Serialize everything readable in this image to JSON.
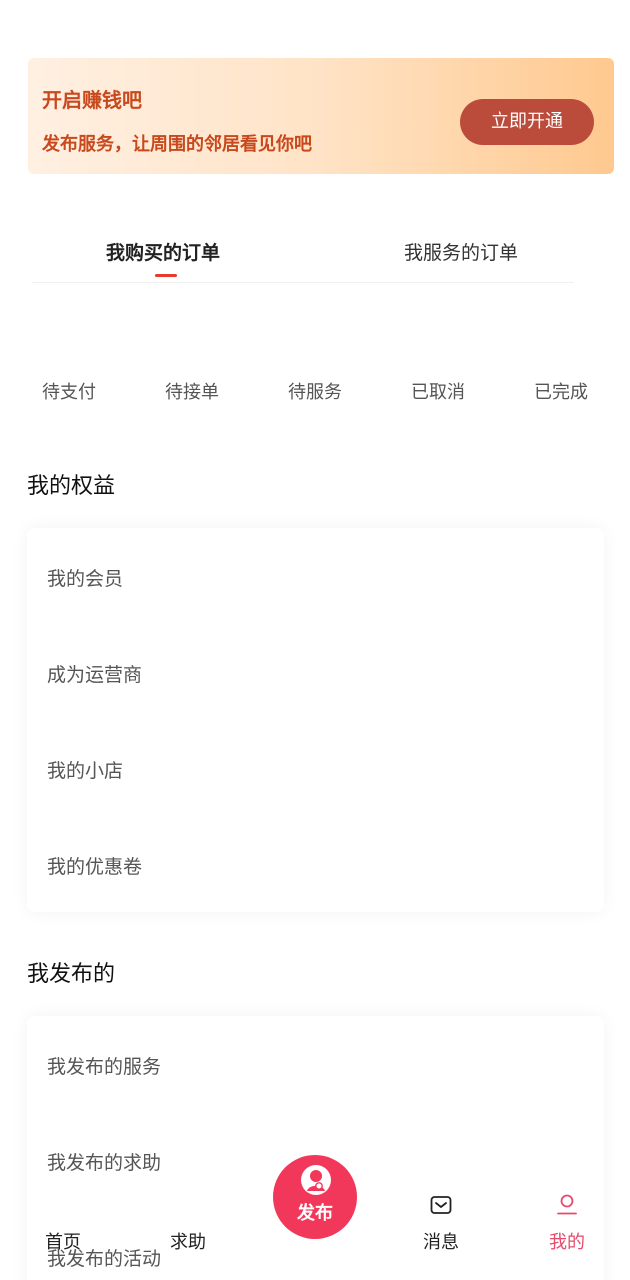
{
  "banner": {
    "title": "开启赚钱吧",
    "subtitle": "发布服务，让周围的邻居看见你吧",
    "button_label": "立即开通"
  },
  "order_tabs": {
    "tab1": "我购买的订单",
    "tab2": "我服务的订单",
    "active": "tab1"
  },
  "order_status": [
    "待支付",
    "待接单",
    "待服务",
    "已取消",
    "已完成"
  ],
  "rights": {
    "title": "我的权益",
    "items": [
      "我的会员",
      "成为运营商",
      "我的小店",
      "我的优惠卷"
    ]
  },
  "published": {
    "title": "我发布的",
    "items": [
      "我发布的服务",
      "我发布的求助",
      "我发布的活动"
    ]
  },
  "bottom_nav": {
    "home": "首页",
    "help": "求助",
    "publish": "发布",
    "messages": "消息",
    "mine": "我的",
    "active": "mine"
  },
  "colors": {
    "accent": "#e64b6b",
    "publish_bg": "#f2385a",
    "banner_text": "#c8491d",
    "banner_button": "#bb4b3a",
    "tab_indicator": "#e63b2e"
  },
  "icons": {
    "publish": "publish-person-icon",
    "messages": "message-envelope-icon",
    "mine": "user-profile-icon"
  }
}
